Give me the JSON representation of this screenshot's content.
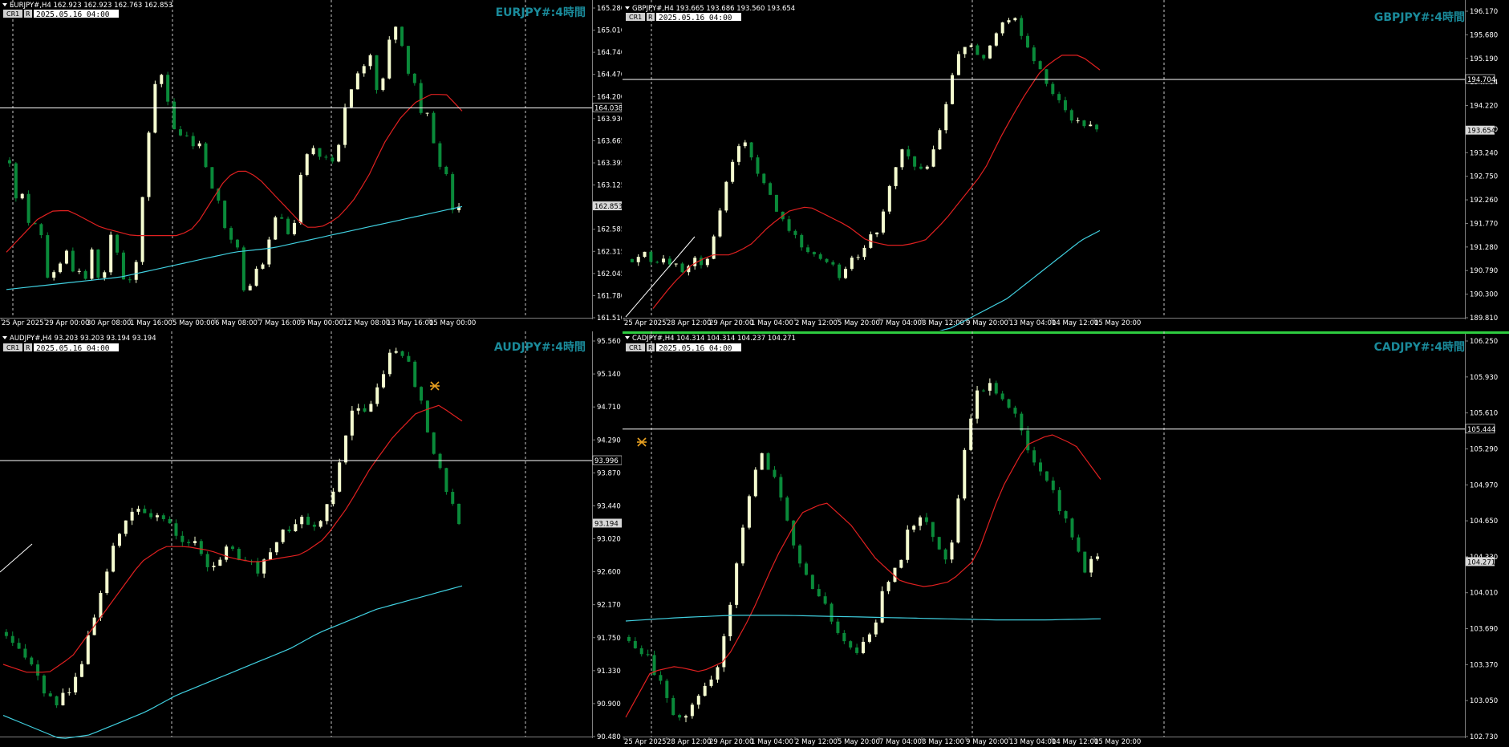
{
  "chart_data": [
    {
      "type": "candlestick",
      "symbol_header": "EURJPY#,H4  162.923 162.923 162.763 162.853",
      "title": "EURJPY#:4時間",
      "badges": [
        "CR1",
        "R"
      ],
      "timestamp": "2025.05.16 04:00",
      "y_ticks": [
        "165.280",
        "165.010",
        "164.740",
        "164.470",
        "164.200",
        "163.930",
        "163.665",
        "163.395",
        "163.125",
        "162.855",
        "162.585",
        "162.315",
        "162.045",
        "161.780",
        "161.510"
      ],
      "ylim": [
        161.51,
        165.28
      ],
      "x_labels": [
        "25 Apr 2025",
        "29 Apr 00:00",
        "30 Apr 08:00",
        "1 May 16:00",
        "5 May 00:00",
        "6 May 08:00",
        "7 May 16:00",
        "9 May 00:00",
        "12 May 08:00",
        "13 May 16:00",
        "15 May 00:00"
      ],
      "hline": {
        "value": 164.038,
        "label": "164.038"
      },
      "price_label": {
        "value": 162.853,
        "label": "162.853"
      },
      "ohlc_close": [
        163.4,
        162.9,
        163.0,
        162.6,
        162.7,
        162.5,
        162.0,
        162.1,
        162.2,
        162.3,
        162.0,
        162.1,
        161.9,
        162.4,
        162.0,
        161.9,
        162.5,
        162.4,
        162.0,
        161.9,
        162.0,
        162.7,
        163.6,
        164.2,
        164.5,
        164.2,
        164.0,
        163.5,
        163.9,
        163.5,
        163.7,
        163.5,
        163.2,
        163.0,
        162.8,
        162.3,
        162.7,
        162.0,
        161.6,
        162.2,
        162.0,
        162.3,
        162.6,
        162.8,
        162.6,
        162.5,
        162.8,
        163.4,
        163.5,
        163.6,
        163.3,
        163.5,
        163.4,
        163.7,
        164.1,
        164.3,
        164.5,
        164.6,
        164.7,
        164.2,
        164.5,
        164.9,
        165.0,
        164.8,
        164.4,
        164.3,
        163.9,
        164.0,
        163.6,
        163.3,
        163.2,
        162.8,
        162.85
      ],
      "ma_red": [
        162.3,
        162.5,
        162.7,
        162.8,
        162.8,
        162.7,
        162.6,
        162.55,
        162.5,
        162.5,
        162.5,
        162.5,
        162.6,
        162.9,
        163.2,
        163.3,
        163.2,
        163.0,
        162.8,
        162.6,
        162.6,
        162.7,
        162.9,
        163.2,
        163.6,
        163.9,
        164.1,
        164.2,
        164.2,
        164.0
      ],
      "ma_cyan": [
        161.85,
        161.9,
        161.95,
        162.0,
        162.1,
        162.2,
        162.3,
        162.35,
        162.45,
        162.55,
        162.65,
        162.75,
        162.85
      ]
    },
    {
      "type": "candlestick",
      "symbol_header": "GBPJPY#,H4  193.665 193.686 193.560 193.654",
      "title": "GBPJPY#:4時間",
      "badges": [
        "CR1",
        "R"
      ],
      "timestamp": "2025.05.16 04:00",
      "y_ticks": [
        "196.170",
        "195.680",
        "195.190",
        "194.704",
        "194.220",
        "193.730",
        "193.240",
        "192.750",
        "192.260",
        "191.770",
        "191.280",
        "190.790",
        "190.300",
        "189.810"
      ],
      "ylim": [
        189.81,
        196.17
      ],
      "x_labels": [
        "25 Apr 2025",
        "28 Apr 12:00",
        "29 Apr 20:00",
        "1 May 04:00",
        "2 May 12:00",
        "5 May 20:00",
        "7 May 04:00",
        "8 May 12:00",
        "9 May 20:00",
        "13 May 04:00",
        "14 May 12:00",
        "15 May 20:00"
      ],
      "hline": {
        "value": 194.704,
        "label": "194.704"
      },
      "price_label": {
        "value": 193.654,
        "label": "193.654"
      }
    },
    {
      "type": "candlestick",
      "symbol_header": "AUDJPY#,H4  93.203 93.203 93.194 93.194",
      "title": "AUDJPY#:4時間",
      "badges": [
        "CR1",
        "R"
      ],
      "timestamp": "2025.05.16 04:00",
      "y_ticks": [
        "95.560",
        "95.140",
        "94.710",
        "94.290",
        "93.870",
        "93.440",
        "93.020",
        "92.600",
        "92.170",
        "91.750",
        "91.330",
        "90.900",
        "90.480"
      ],
      "ylim": [
        90.48,
        95.56
      ],
      "hline": {
        "value": 93.996,
        "label": "93.996"
      },
      "price_label": {
        "value": 93.194,
        "label": "93.194"
      }
    },
    {
      "type": "candlestick",
      "symbol_header": "CADJPY#,H4  104.314 104.314 104.237 104.271",
      "title": "CADJPY#:4時間",
      "badges": [
        "CR1",
        "R"
      ],
      "timestamp": "2025.05.16 04:00",
      "y_ticks": [
        "106.250",
        "105.930",
        "105.610",
        "105.290",
        "104.970",
        "104.650",
        "104.330",
        "104.010",
        "103.690",
        "103.370",
        "103.050",
        "102.730"
      ],
      "ylim": [
        102.73,
        106.25
      ],
      "x_labels": [
        "25 Apr 2025",
        "28 Apr 12:00",
        "29 Apr 20:00",
        "1 May 04:00",
        "2 May 12:00",
        "5 May 20:00",
        "7 May 04:00",
        "8 May 12:00",
        "9 May 20:00",
        "13 May 04:00",
        "14 May 12:00",
        "15 May 20:00"
      ],
      "hline": {
        "value": 105.444,
        "label": "105.444"
      },
      "price_label": {
        "value": 104.271,
        "label": "104.271"
      }
    }
  ],
  "colors": {
    "bull_body": "#f5fcd0",
    "bear_body": "#0a8a3a",
    "ma_red": "#e02020",
    "ma_cyan": "#40d0e0",
    "title_color": "#1a8a9a",
    "grid_dash": "#c8c8c8",
    "axis_text": "#ffffff",
    "hline": "#ffffff"
  }
}
